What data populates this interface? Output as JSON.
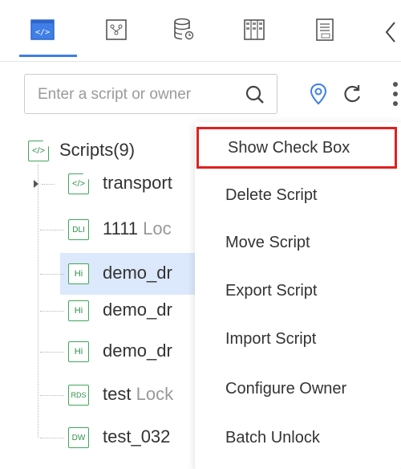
{
  "toolbar": {
    "tabs": [
      {
        "name": "script-tab",
        "icon": "code-icon",
        "active": true
      },
      {
        "name": "components-tab",
        "icon": "nodes-icon",
        "active": false
      },
      {
        "name": "data-tab",
        "icon": "database-icon",
        "active": false
      },
      {
        "name": "resources-tab",
        "icon": "grid-icon",
        "active": false
      },
      {
        "name": "docs-tab",
        "icon": "document-icon",
        "active": false
      }
    ],
    "accent_color": "#3f7fe7"
  },
  "search": {
    "placeholder": "Enter a script or owner"
  },
  "tree": {
    "root_label": "Scripts(9)",
    "items": [
      {
        "badge": "</>",
        "label": "transport",
        "lock": ""
      },
      {
        "badge": "DLI",
        "label": "1111",
        "lock": "Loc"
      },
      {
        "badge": "Hi",
        "label": "demo_dr",
        "lock": ""
      },
      {
        "badge": "Hi",
        "label": "demo_dr",
        "lock": ""
      },
      {
        "badge": "Hi",
        "label": "demo_dr",
        "lock": ""
      },
      {
        "badge": "RDS",
        "label": "test",
        "lock": "Lock"
      },
      {
        "badge": "DW",
        "label": "test_032",
        "lock": ""
      }
    ]
  },
  "context_menu": {
    "items": [
      "Show Check Box",
      "Delete Script",
      "Move Script",
      "Export Script",
      "Import Script",
      "Configure Owner",
      "Batch Unlock"
    ],
    "highlight_color": "#e02020"
  }
}
